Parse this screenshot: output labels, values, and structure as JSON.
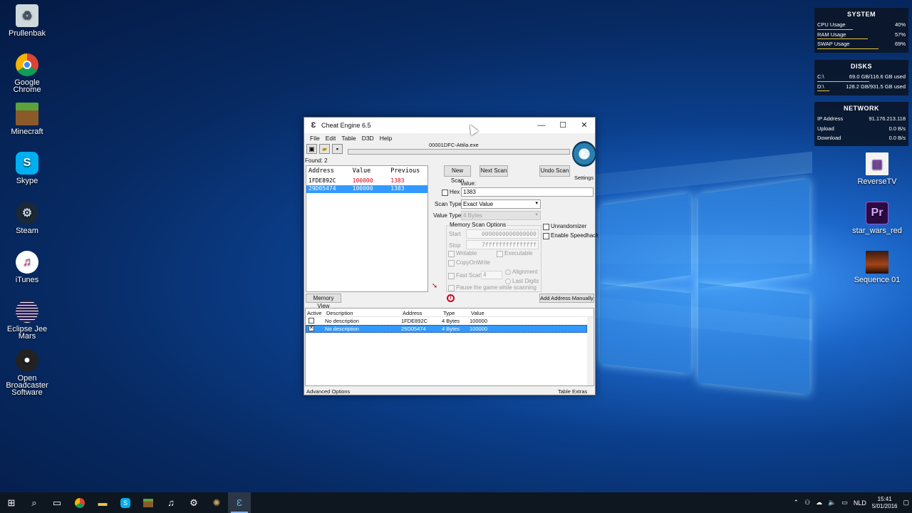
{
  "desktop_icons": [
    {
      "label": "Prullenbak",
      "icon": "recycle-bin-icon"
    },
    {
      "label": "Google Chrome",
      "icon": "chrome-icon"
    },
    {
      "label": "Minecraft",
      "icon": "minecraft-icon"
    },
    {
      "label": "Skype",
      "icon": "skype-icon"
    },
    {
      "label": "Steam",
      "icon": "steam-icon"
    },
    {
      "label": "iTunes",
      "icon": "itunes-icon"
    },
    {
      "label": "Eclipse Jee Mars",
      "icon": "eclipse-icon"
    },
    {
      "label": "Open Broadcaster Software",
      "icon": "obs-icon"
    },
    {
      "label": "ReverseTV",
      "icon": "file-icon"
    },
    {
      "label": "star_wars_red",
      "icon": "premiere-icon"
    },
    {
      "label": "Sequence 01",
      "icon": "video-file-icon"
    }
  ],
  "widgets": {
    "system": {
      "title": "SYSTEM",
      "rows": [
        {
          "label": "CPU Usage",
          "value": "40%",
          "level": 0.4
        },
        {
          "label": "RAM Usage",
          "value": "57%",
          "level": 0.57
        },
        {
          "label": "SWAP Usage",
          "value": "69%",
          "level": 0.69
        }
      ]
    },
    "disks": {
      "title": "DISKS",
      "rows": [
        {
          "label": "C:\\",
          "value": "69.0 GB/116.6 GB used",
          "level": 0.59
        },
        {
          "label": "D:\\",
          "value": "128.2 GB/931.5 GB used",
          "level": 0.14
        }
      ]
    },
    "network": {
      "title": "NETWORK",
      "rows": [
        {
          "label": "IP Address",
          "value": "91.176.213.118"
        },
        {
          "label": "Upload",
          "value": "0.0 B/s"
        },
        {
          "label": "Download",
          "value": "0.0 B/s"
        }
      ]
    }
  },
  "window": {
    "title": "Cheat Engine 6.5",
    "controls": {
      "minimize": "—",
      "maximize": "☐",
      "close": "✕"
    },
    "menu": [
      "File",
      "Edit",
      "Table",
      "D3D",
      "Help"
    ],
    "process": "00001DFC-Attila.exe",
    "found": "Found: 2",
    "settings_label": "Settings",
    "results": {
      "headers": [
        "Address",
        "Value",
        "Previous"
      ],
      "rows": [
        {
          "address": "1FDE892C",
          "value": "100000",
          "previous": "1383",
          "selected": false
        },
        {
          "address": "29D05474",
          "value": "100000",
          "previous": "1383",
          "selected": true
        }
      ]
    },
    "buttons": {
      "new_scan": "New Scan",
      "next_scan": "Next Scan",
      "undo_scan": "Undo Scan",
      "memory_view": "Memory View",
      "add_address": "Add Address Manually"
    },
    "scan": {
      "value_label": "Value:",
      "hex_label": "Hex",
      "value": "1383",
      "scan_type_label": "Scan Type",
      "scan_type": "Exact Value",
      "value_type_label": "Value Type",
      "value_type": "4 Bytes"
    },
    "memory_options": {
      "title": "Memory Scan Options",
      "start_label": "Start",
      "start": "0000000000000000",
      "stop_label": "Stop",
      "stop": "7fffffffffffffff",
      "writable": "Writable",
      "executable": "Executable",
      "copyonwrite": "CopyOnWrite",
      "fast_scan": "Fast Scan",
      "fast_scan_value": "4",
      "alignment": "Alignment",
      "last_digits": "Last Digits",
      "pause": "Pause the game while scanning"
    },
    "right_options": {
      "unrandomizer": "Unrandomizer",
      "speedhack": "Enable Speedhack"
    },
    "table": {
      "headers": [
        "Active",
        "Description",
        "Address",
        "Type",
        "Value"
      ],
      "rows": [
        {
          "description": "No description",
          "address": "1FDE892C",
          "type": "4 Bytes",
          "value": "100000",
          "selected": false
        },
        {
          "description": "No description",
          "address": "29D05474",
          "type": "4 Bytes",
          "value": "100000",
          "selected": true
        }
      ]
    },
    "footer": {
      "left": "Advanced Options",
      "right": "Table Extras"
    }
  },
  "taskbar": {
    "icons": [
      "windows-start-icon",
      "search-icon",
      "task-view-icon",
      "chrome-icon",
      "file-explorer-icon",
      "skype-icon",
      "minecraft-icon",
      "itunes-icon",
      "steam-icon",
      "attila-icon",
      "cheat-engine-icon"
    ],
    "language": "NLD",
    "time": "15:41",
    "date": "5/01/2016"
  }
}
